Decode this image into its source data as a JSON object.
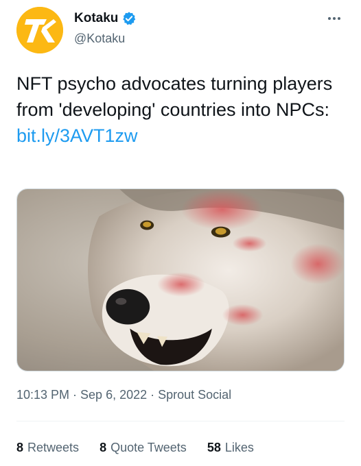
{
  "author": {
    "display_name": "Kotaku",
    "handle": "@Kotaku",
    "verified": true,
    "avatar_icon": "kotaku-logo",
    "brand_color": "#fcb813"
  },
  "tweet": {
    "text": "NFT psycho advocates turning players from 'developing' countries into NPCs:",
    "link": "bit.ly/3AVT1zw",
    "link_color": "#1d9bf0",
    "media_alt": "wolf photo"
  },
  "meta": {
    "timestamp": "10:13 PM · Sep 6, 2022 · Sprout Social"
  },
  "stats": [
    {
      "count": "8",
      "label": "Retweets"
    },
    {
      "count": "8",
      "label": "Quote Tweets"
    },
    {
      "count": "58",
      "label": "Likes"
    }
  ],
  "icons": {
    "more": "more-horizontal-icon",
    "verified": "verified-badge-icon"
  }
}
